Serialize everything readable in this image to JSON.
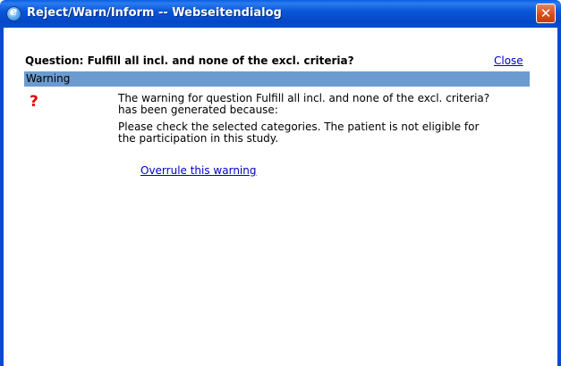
{
  "window": {
    "title": "Reject/Warn/Inform -- Webseitendialog",
    "icon": "ie-icon",
    "close_glyph": "✕"
  },
  "dialog": {
    "question": "Question: Fulfill all incl. and none of the excl. criteria?",
    "close_link": "Close",
    "bar_label": "Warning",
    "status_icon": "?",
    "message_line1": "The warning for question Fulfill all incl. and none of the excl. criteria? has been generated because:",
    "message_line2": "Please check the selected categories. The patient is not eligible for the participation in this study.",
    "overrule_link": "Overrule this warning"
  },
  "colors": {
    "titlebar": "#0a56d8",
    "warning_bar": "#6c9bd2",
    "link": "#0000cc",
    "question_mark": "#e00000"
  }
}
